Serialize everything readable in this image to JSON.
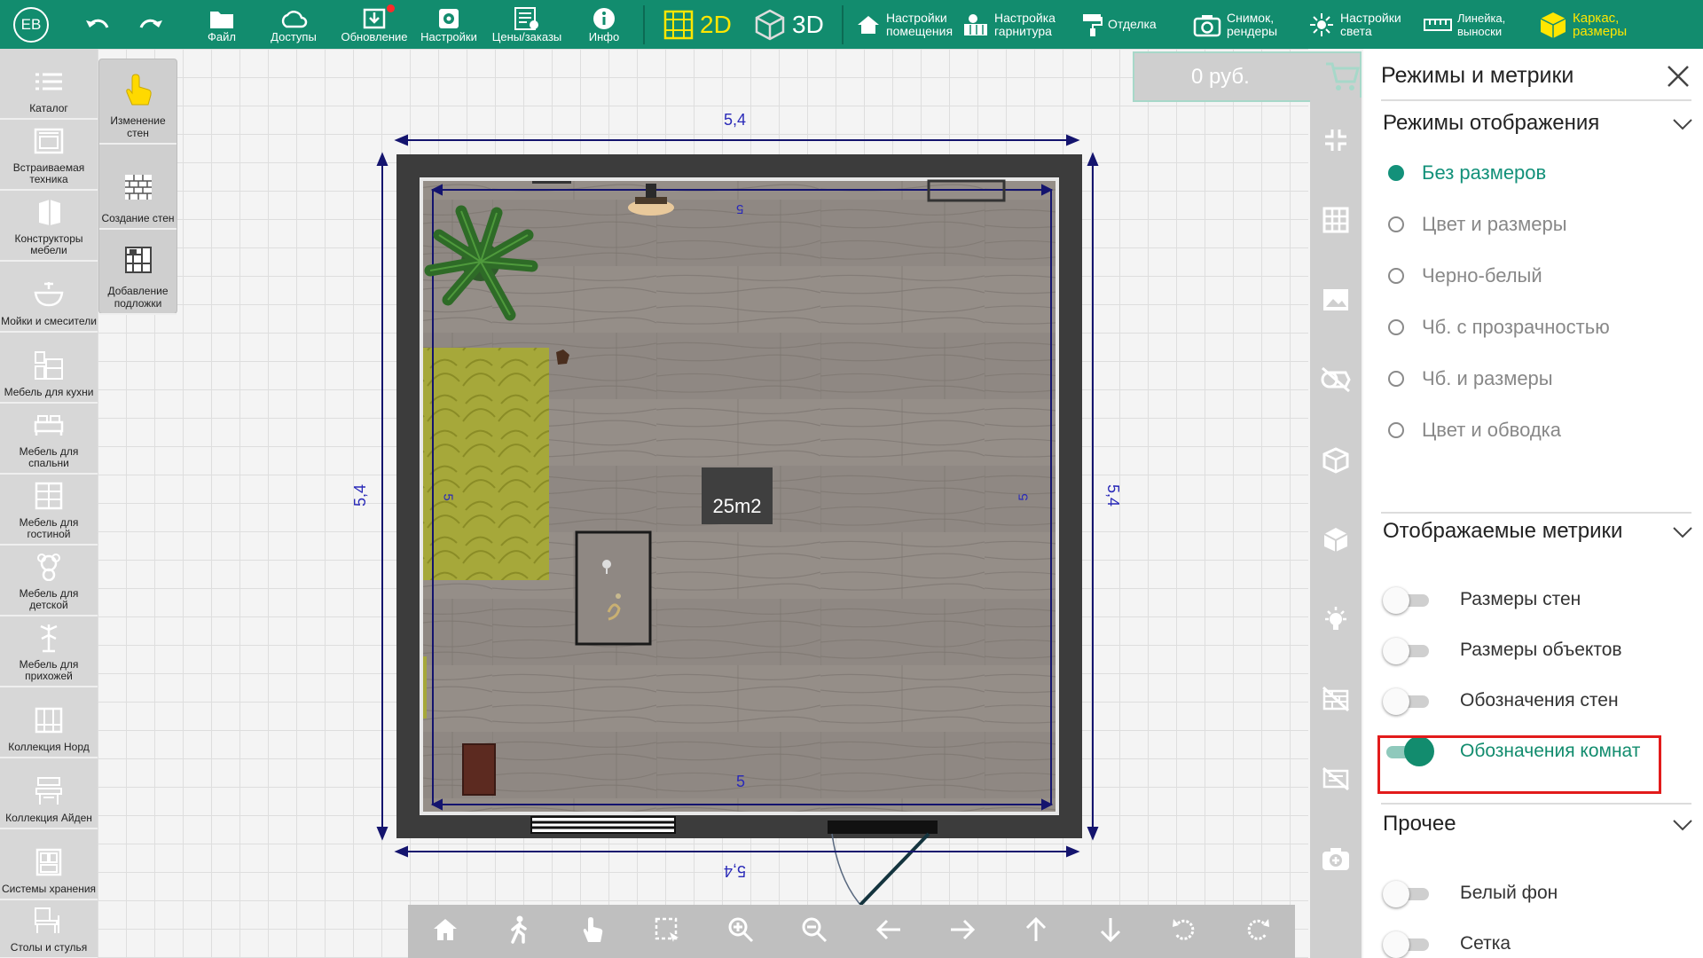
{
  "topbar": {
    "avatar": "ЕВ",
    "file": "Файл",
    "access": "Доступы",
    "update": "Обновление",
    "settings": "Настройки",
    "prices": "Цены/заказы",
    "info": "Инфо",
    "mode_2d": "2D",
    "mode_3d": "3D",
    "room_settings": [
      "Настройки",
      "помещения"
    ],
    "set_settings": [
      "Настройка",
      "гарнитура"
    ],
    "finish": "Отделка",
    "snapshot": [
      "Снимок,",
      "рендеры"
    ],
    "light_settings": [
      "Настройки",
      "света"
    ],
    "ruler": [
      "Линейка,",
      "выноски"
    ],
    "frame": [
      "Каркас,",
      "размеры"
    ]
  },
  "sidebar": {
    "items": [
      {
        "label": "Каталог",
        "icon": "list-icon"
      },
      {
        "label": "Встраиваемая техника",
        "icon": "oven-icon"
      },
      {
        "label": "Конструкторы мебели",
        "icon": "cabinet-icon"
      },
      {
        "label": "Мойки и смесители",
        "icon": "sink-icon"
      },
      {
        "label": "Мебель для кухни",
        "icon": "kitchen-icon"
      },
      {
        "label": "Мебель для спальни",
        "icon": "bed-icon"
      },
      {
        "label": "Мебель для гостиной",
        "icon": "shelf-icon"
      },
      {
        "label": "Мебель для детской",
        "icon": "teddy-icon"
      },
      {
        "label": "Мебель для прихожей",
        "icon": "hanger-icon"
      },
      {
        "label": "Коллекция Норд",
        "icon": "wardrobe-icon"
      },
      {
        "label": "Коллекция Айден",
        "icon": "desk-icon"
      },
      {
        "label": "Системы хранения",
        "icon": "storage-icon"
      },
      {
        "label": "Столы и стулья",
        "icon": "chair-icon"
      }
    ]
  },
  "subpanel": {
    "items": [
      {
        "label": "Изменение стен",
        "icon": "hand-icon"
      },
      {
        "label": "Создание стен",
        "icon": "brick-icon"
      },
      {
        "label": "Добавление подложки",
        "icon": "underlay-icon"
      }
    ]
  },
  "price": {
    "value": "0 руб."
  },
  "plan": {
    "outer_top": "5,4",
    "outer_bottom": "5,4",
    "outer_left": "5,4",
    "outer_right": "5,4",
    "inner_top": "5",
    "inner_bottom": "5",
    "inner_left": "5",
    "inner_right": "5",
    "area": "25m2"
  },
  "panel": {
    "title": "Режимы и метрики",
    "display_modes": {
      "header": "Режимы отображения",
      "options": [
        "Без размеров",
        "Цвет и размеры",
        "Черно-белый",
        "Чб. с прозрачностью",
        "Чб. и размеры",
        "Цвет и обводка"
      ],
      "selected": "Без размеров"
    },
    "metrics": {
      "header": "Отображаемые метрики",
      "items": [
        {
          "label": "Размеры стен",
          "on": false
        },
        {
          "label": "Размеры объектов",
          "on": false
        },
        {
          "label": "Обозначения стен",
          "on": false
        },
        {
          "label": "Обозначения комнат",
          "on": true
        }
      ]
    },
    "other": {
      "header": "Прочее",
      "items": [
        {
          "label": "Белый фон",
          "on": false
        },
        {
          "label": "Сетка",
          "on": false
        }
      ]
    }
  },
  "colors": {
    "accent": "#128c6e",
    "highlight": "#e21b1b",
    "dimension": "#14146e"
  }
}
